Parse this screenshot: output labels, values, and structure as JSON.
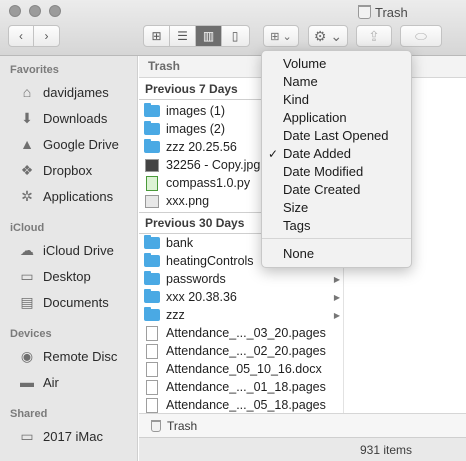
{
  "window": {
    "title": "Trash"
  },
  "toolbar": {
    "back_icon": "chevron-left-icon",
    "forward_icon": "chevron-right-icon",
    "view_modes": [
      "icon-view",
      "list-view",
      "column-view",
      "coverflow-view"
    ],
    "active_view": "column-view",
    "arrange_icon": "arrange-grid-icon",
    "action_icon": "gear-icon",
    "share_icon": "share-icon",
    "tag_icon": "tag-icon"
  },
  "sidebar": {
    "sections": [
      {
        "title": "Favorites",
        "items": [
          {
            "label": "davidjames",
            "icon": "home-icon"
          },
          {
            "label": "Downloads",
            "icon": "downloads-icon"
          },
          {
            "label": "Google Drive",
            "icon": "google-drive-icon"
          },
          {
            "label": "Dropbox",
            "icon": "dropbox-icon"
          },
          {
            "label": "Applications",
            "icon": "applications-icon"
          }
        ]
      },
      {
        "title": "iCloud",
        "items": [
          {
            "label": "iCloud Drive",
            "icon": "cloud-icon"
          },
          {
            "label": "Desktop",
            "icon": "desktop-icon"
          },
          {
            "label": "Documents",
            "icon": "documents-icon"
          }
        ]
      },
      {
        "title": "Devices",
        "items": [
          {
            "label": "Remote Disc",
            "icon": "disc-icon"
          },
          {
            "label": "Air",
            "icon": "drive-icon"
          }
        ]
      },
      {
        "title": "Shared",
        "items": [
          {
            "label": "2017 iMac",
            "icon": "imac-icon"
          }
        ]
      }
    ]
  },
  "column": {
    "header": "Trash",
    "groups": [
      {
        "title": "Previous 7 Days",
        "items": [
          {
            "name": "images (1)",
            "type": "folder",
            "has_children": false
          },
          {
            "name": "images (2)",
            "type": "folder",
            "has_children": false
          },
          {
            "name": "zzz 20.25.56",
            "type": "folder",
            "has_children": false
          },
          {
            "name": "32256 - Copy.jpg",
            "type": "image",
            "has_children": false
          },
          {
            "name": "compass1.0.py",
            "type": "python",
            "has_children": false
          },
          {
            "name": "xxx.png",
            "type": "image",
            "has_children": false
          }
        ]
      },
      {
        "title": "Previous 30 Days",
        "items": [
          {
            "name": "bank",
            "type": "folder",
            "has_children": false
          },
          {
            "name": "heatingControls",
            "type": "folder",
            "has_children": false
          },
          {
            "name": "passwords",
            "type": "folder",
            "has_children": true
          },
          {
            "name": "xxx 20.38.36",
            "type": "folder",
            "has_children": true
          },
          {
            "name": "zzz",
            "type": "folder",
            "has_children": true
          },
          {
            "name": "Attendance_..._03_20.pages",
            "type": "doc",
            "has_children": false
          },
          {
            "name": "Attendance_..._02_20.pages",
            "type": "doc",
            "has_children": false
          },
          {
            "name": "Attendance_05_10_16.docx",
            "type": "doc",
            "has_children": false
          },
          {
            "name": "Attendance_..._01_18.pages",
            "type": "doc",
            "has_children": false
          },
          {
            "name": "Attendance_..._05_18.pages",
            "type": "doc",
            "has_children": false
          }
        ]
      }
    ]
  },
  "path_bar": {
    "label": "Trash",
    "icon": "trash-icon"
  },
  "status_bar": {
    "text": "931 items"
  },
  "arrange_menu": {
    "items": [
      "Volume",
      "Name",
      "Kind",
      "Application",
      "Date Last Opened",
      "Date Added",
      "Date Modified",
      "Date Created",
      "Size",
      "Tags"
    ],
    "checked": "Date Added",
    "none_label": "None",
    "check_glyph": "✓"
  }
}
